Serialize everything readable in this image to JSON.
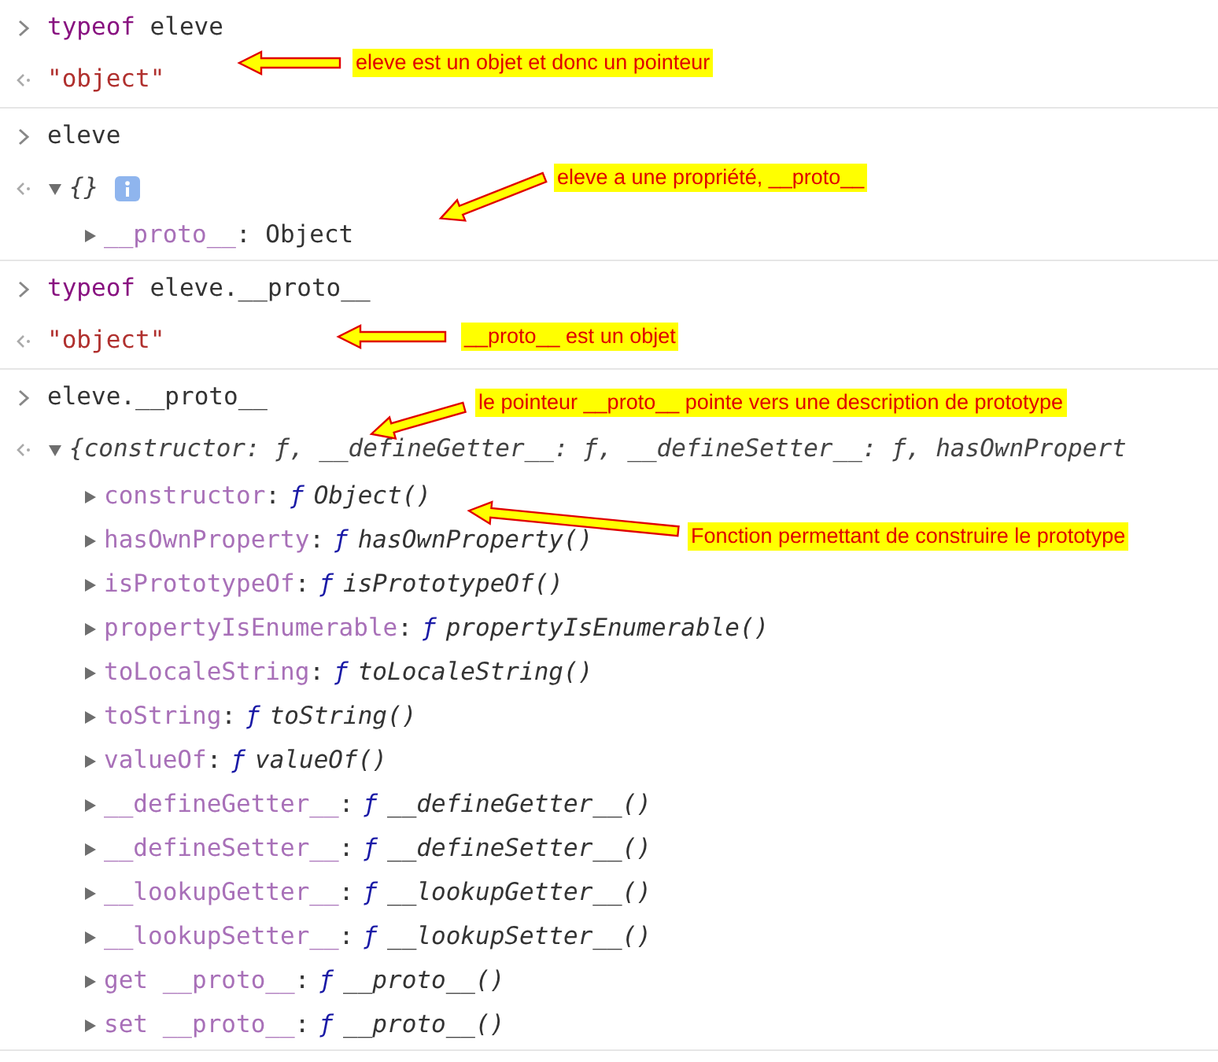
{
  "entries": [
    {
      "input": {
        "keyword": "typeof",
        "code": "eleve"
      },
      "output": {
        "kind": "string",
        "text": "\"object\""
      },
      "note": {
        "text": "eleve est un objet et donc un pointeur"
      }
    },
    {
      "input": {
        "code": "eleve"
      },
      "output": {
        "kind": "object",
        "summary": "{}",
        "info_badge": true,
        "expanded": true,
        "properties": [
          {
            "key": "__proto__",
            "separator": ":",
            "kind": "plain",
            "value": "Object",
            "expanded": false
          }
        ]
      },
      "note": {
        "text": "eleve a une propriété, __proto__"
      }
    },
    {
      "input": {
        "keyword": "typeof",
        "code": "eleve.__proto__"
      },
      "output": {
        "kind": "string",
        "text": "\"object\""
      },
      "note": {
        "text": "__proto__ est un objet"
      }
    },
    {
      "input": {
        "code": "eleve.__proto__"
      },
      "output": {
        "kind": "object",
        "summary": "{constructor: ƒ, __defineGetter__: ƒ, __defineSetter__: ƒ, hasOwnPropert",
        "info_badge": false,
        "expanded": true,
        "properties": [
          {
            "key": "constructor",
            "separator": ":",
            "kind": "function",
            "sign": "ƒ",
            "value": "Object()",
            "expanded": false,
            "note": {
              "text": "Fonction permettant de construire le prototype"
            }
          },
          {
            "key": "hasOwnProperty",
            "separator": ":",
            "kind": "function",
            "sign": "ƒ",
            "value": "hasOwnProperty()",
            "expanded": false
          },
          {
            "key": "isPrototypeOf",
            "separator": ":",
            "kind": "function",
            "sign": "ƒ",
            "value": "isPrototypeOf()",
            "expanded": false
          },
          {
            "key": "propertyIsEnumerable",
            "separator": ":",
            "kind": "function",
            "sign": "ƒ",
            "value": "propertyIsEnumerable()",
            "expanded": false
          },
          {
            "key": "toLocaleString",
            "separator": ":",
            "kind": "function",
            "sign": "ƒ",
            "value": "toLocaleString()",
            "expanded": false
          },
          {
            "key": "toString",
            "separator": ":",
            "kind": "function",
            "sign": "ƒ",
            "value": "toString()",
            "expanded": false
          },
          {
            "key": "valueOf",
            "separator": ":",
            "kind": "function",
            "sign": "ƒ",
            "value": "valueOf()",
            "expanded": false
          },
          {
            "key": "__defineGetter__",
            "separator": ":",
            "kind": "function",
            "sign": "ƒ",
            "value": "__defineGetter__()",
            "expanded": false
          },
          {
            "key": "__defineSetter__",
            "separator": ":",
            "kind": "function",
            "sign": "ƒ",
            "value": "__defineSetter__()",
            "expanded": false
          },
          {
            "key": "__lookupGetter__",
            "separator": ":",
            "kind": "function",
            "sign": "ƒ",
            "value": "__lookupGetter__()",
            "expanded": false
          },
          {
            "key": "__lookupSetter__",
            "separator": ":",
            "kind": "function",
            "sign": "ƒ",
            "value": "__lookupSetter__()",
            "expanded": false
          },
          {
            "key": "get __proto__",
            "separator": ":",
            "kind": "function",
            "sign": "ƒ",
            "value": "__proto__()",
            "expanded": false
          },
          {
            "key": "set __proto__",
            "separator": ":",
            "kind": "function",
            "sign": "ƒ",
            "value": "__proto__()",
            "expanded": false
          }
        ]
      },
      "note": {
        "text": "le pointeur  __proto__ pointe vers une description de prototype"
      }
    }
  ]
}
